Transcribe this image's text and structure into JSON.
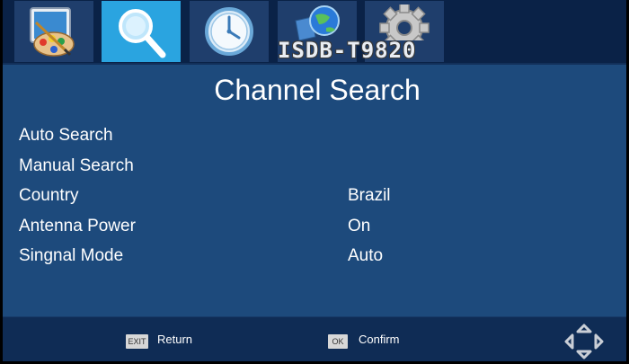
{
  "header": {
    "tabs": [
      {
        "icon": "paint-palette-icon"
      },
      {
        "icon": "magnifier-icon",
        "active": true
      },
      {
        "icon": "clock-icon"
      },
      {
        "icon": "globe-folder-icon"
      },
      {
        "icon": "gear-icon"
      }
    ],
    "model": "ISDB-T9820"
  },
  "page": {
    "title": "Channel Search"
  },
  "menu": [
    {
      "label": "Auto Search",
      "value": ""
    },
    {
      "label": "Manual Search",
      "value": ""
    },
    {
      "label": "Country",
      "value": "Brazil"
    },
    {
      "label": "Antenna Power",
      "value": "On"
    },
    {
      "label": "Singnal Mode",
      "value": "Auto"
    }
  ],
  "footer": {
    "exit_key": "EXIT",
    "return_label": "Return",
    "ok_key": "OK",
    "confirm_label": "Confirm",
    "nav_icon": "direction-pad-icon"
  },
  "colors": {
    "background": "#1d4a7c",
    "tabbar": "#0a2247",
    "active_tab": "#2aa4e0",
    "footer": "#0f2c55"
  }
}
